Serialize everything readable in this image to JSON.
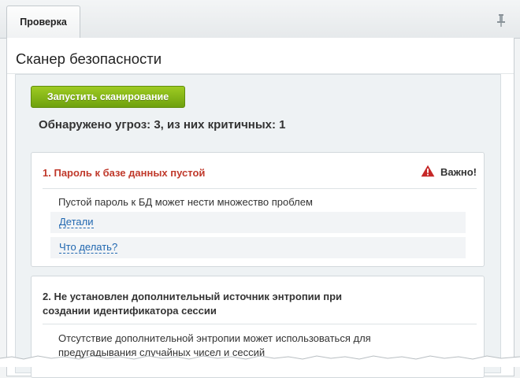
{
  "tabs": [
    {
      "label": "Проверка"
    }
  ],
  "page": {
    "title": "Сканер безопасности"
  },
  "scan": {
    "button_label": "Запустить сканирование",
    "summary": "Обнаружено угроз: 3, из них критичных: 1"
  },
  "threats": [
    {
      "number": "1.",
      "title": "Пароль к базе данных пустой",
      "severity": "critical",
      "badge": "Важно!",
      "description": "Пустой пароль к БД может нести множество проблем",
      "details_link": "Детали",
      "fix_link": "Что делать?"
    },
    {
      "number": "2.",
      "title_line1": "Не установлен дополнительный источник энтропии при",
      "title_line2": "создании идентификатора сессии",
      "description_line1": "Отсутствие дополнительной энтропии может использоваться для",
      "description_line2": "предугадывания случайных чисел и сессий"
    }
  ],
  "icons": {
    "pin": "pin-icon",
    "warning": "warning-triangle-icon"
  },
  "colors": {
    "critical": "#c0392b",
    "button": "#7fb315",
    "link": "#2067b0"
  }
}
